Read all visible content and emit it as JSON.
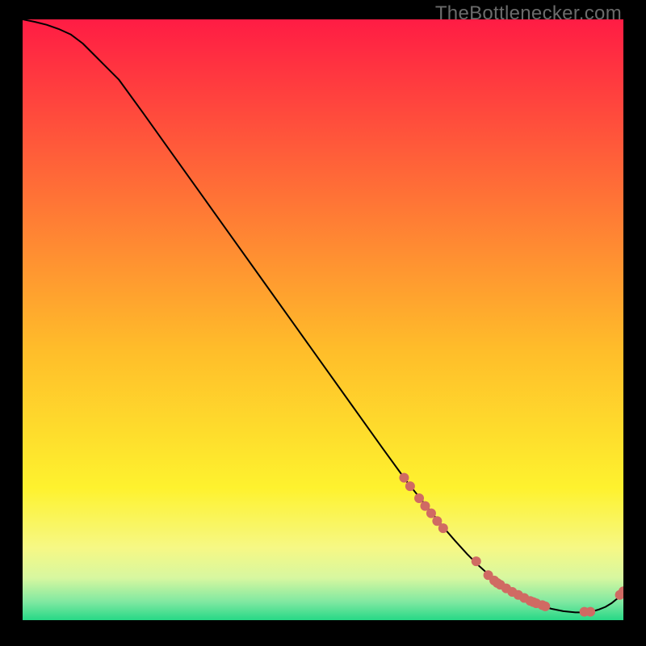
{
  "watermark": "TheBottlenecker.com",
  "chart_data": {
    "type": "line",
    "title": "",
    "xlabel": "",
    "ylabel": "",
    "xlim": [
      0,
      100
    ],
    "ylim": [
      0,
      100
    ],
    "grid": false,
    "legend": false,
    "background_gradient": {
      "stops": [
        {
          "offset": 0.0,
          "color": "#ff1c44"
        },
        {
          "offset": 0.55,
          "color": "#ffbd2a"
        },
        {
          "offset": 0.78,
          "color": "#fef22e"
        },
        {
          "offset": 0.88,
          "color": "#f6f885"
        },
        {
          "offset": 0.93,
          "color": "#d7f7a0"
        },
        {
          "offset": 0.97,
          "color": "#7ee8a1"
        },
        {
          "offset": 1.0,
          "color": "#27d886"
        }
      ]
    },
    "series": [
      {
        "name": "bottleneck-curve",
        "stroke": "#000000",
        "stroke_width": 2,
        "x": [
          0,
          2,
          4,
          6,
          8,
          10,
          12,
          16,
          20,
          25,
          30,
          35,
          40,
          45,
          50,
          55,
          60,
          64,
          66,
          68,
          70,
          72,
          74,
          76,
          78,
          80,
          82,
          84,
          86,
          88,
          90,
          92,
          94,
          95,
          96,
          97,
          98,
          99,
          100
        ],
        "y": [
          100,
          99.6,
          99.1,
          98.4,
          97.5,
          96.0,
          94.0,
          90.0,
          84.5,
          77.5,
          70.5,
          63.5,
          56.5,
          49.5,
          42.5,
          35.5,
          28.5,
          23.0,
          20.5,
          18.0,
          15.5,
          13.2,
          11.0,
          9.0,
          7.2,
          5.6,
          4.3,
          3.3,
          2.5,
          1.9,
          1.5,
          1.3,
          1.3,
          1.5,
          1.8,
          2.2,
          2.8,
          3.6,
          4.6
        ]
      }
    ],
    "markers": [
      {
        "name": "highlight-points",
        "shape": "circle",
        "color": "#d06a63",
        "radius": 6,
        "points": [
          {
            "x": 63.5,
            "y": 23.7
          },
          {
            "x": 64.5,
            "y": 22.3
          },
          {
            "x": 66.0,
            "y": 20.3
          },
          {
            "x": 67.0,
            "y": 19.0
          },
          {
            "x": 68.0,
            "y": 17.8
          },
          {
            "x": 69.0,
            "y": 16.5
          },
          {
            "x": 70.0,
            "y": 15.3
          },
          {
            "x": 75.5,
            "y": 9.8
          },
          {
            "x": 77.5,
            "y": 7.5
          },
          {
            "x": 78.5,
            "y": 6.6
          },
          {
            "x": 79.0,
            "y": 6.2
          },
          {
            "x": 79.5,
            "y": 5.9
          },
          {
            "x": 80.5,
            "y": 5.3
          },
          {
            "x": 81.5,
            "y": 4.7
          },
          {
            "x": 82.5,
            "y": 4.2
          },
          {
            "x": 83.5,
            "y": 3.7
          },
          {
            "x": 84.5,
            "y": 3.2
          },
          {
            "x": 85.0,
            "y": 3.0
          },
          {
            "x": 85.5,
            "y": 2.8
          },
          {
            "x": 86.5,
            "y": 2.5
          },
          {
            "x": 87.0,
            "y": 2.3
          },
          {
            "x": 93.5,
            "y": 1.4
          },
          {
            "x": 94.5,
            "y": 1.4
          },
          {
            "x": 99.4,
            "y": 4.2
          },
          {
            "x": 100.0,
            "y": 4.8
          }
        ]
      }
    ]
  }
}
